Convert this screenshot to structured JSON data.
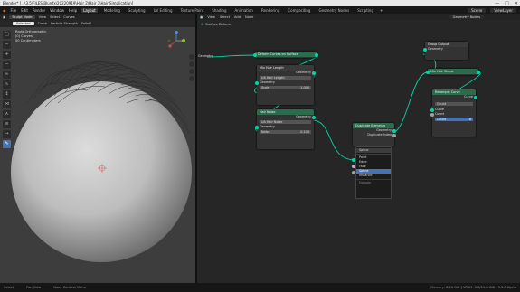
{
  "window": {
    "title": "Blender* [...\\3.5\\FILES\\Blurrfx\\20220919\\Hair 2\\Hair 3\\Hair Simplication]"
  },
  "menubar": {
    "app_menus": [
      "File",
      "Edit",
      "Render",
      "Window",
      "Help"
    ],
    "workspace_tabs": [
      "Layout",
      "Modeling",
      "Sculpting",
      "UV Editing",
      "Texture Paint",
      "Shading",
      "Animation",
      "Rendering",
      "Compositing",
      "Geometry Nodes",
      "Scripting"
    ],
    "active_tab": "Layout",
    "scene": "Scene",
    "view_layer": "ViewLayer"
  },
  "viewport": {
    "header_menus": [
      "Sculpt Mode",
      "View",
      "Select",
      "Curves"
    ],
    "mode": "Sculpt Mode",
    "toolbar2": [
      "Selected",
      "Comb",
      "Particle Strength",
      "Falloff"
    ],
    "overlay_lines": [
      "Right Orthographic",
      "(0) Curves",
      "50 Centimeters"
    ]
  },
  "node_editor": {
    "header_menus": [
      "View",
      "Select",
      "Add",
      "Node"
    ],
    "node_tree_name": "Geometry Nodes",
    "breadcrumb": "Surface Deform",
    "nodes": {
      "deform": {
        "title": "Deform Curves on Surface",
        "socket": "Curves"
      },
      "length": {
        "title": "Mix Hair Length",
        "group": "UA Hair Length",
        "row_geometry": "Geometry",
        "field_label": "Scale",
        "field_value": "1.000"
      },
      "noise": {
        "title": "Hair Noise",
        "group": "UA Hair Noise",
        "row_geometry": "Geometry",
        "field_label": "Noise",
        "field_value": "0.100"
      },
      "duplicate": {
        "title": "Duplicate Elements",
        "row_geometry": "Geometry",
        "row_index": "Duplicate Index",
        "domain": "Spline"
      },
      "group_output": {
        "title": "Group Output",
        "row_geometry": "Geometry"
      },
      "hair_shape": {
        "title": "Mix Hair Shape"
      },
      "resample": {
        "title": "Resample Curve",
        "row_curve": "Curve",
        "mode": "Count",
        "row_count": "Count",
        "count_value": "16"
      }
    },
    "left_socket_label": "Geometry",
    "dropdown": {
      "items": [
        "Spline",
        "Point",
        "Edge",
        "Face",
        "Spline",
        "Instance"
      ],
      "active_index": 4,
      "footer": "Domain"
    }
  },
  "statusbar": {
    "items": [
      "Select",
      "Pan View",
      "Node Context Menu"
    ],
    "version": "Memory: 8.10 GiB | VRAM: 0.6/11.0 GiB | 3.3.0 Alpha"
  },
  "colors": {
    "geometry_socket": "#00d6a3",
    "node_header_geometry": "#2c6b4c",
    "selection_blue": "#4772b3"
  }
}
